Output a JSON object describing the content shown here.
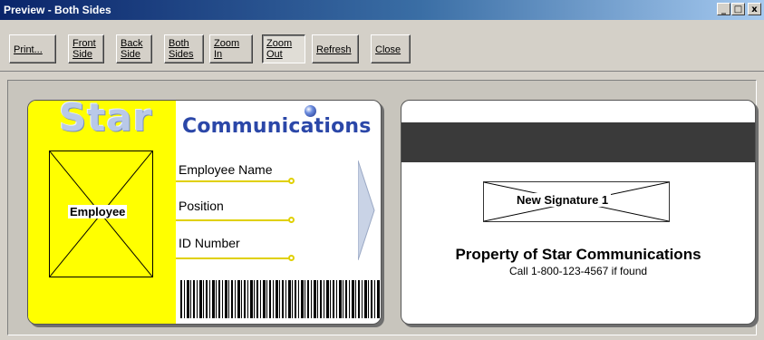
{
  "window": {
    "title": "Preview - Both Sides",
    "controls": {
      "minimize": "_",
      "maximize": "□",
      "close": "x"
    }
  },
  "toolbar": {
    "print": "Print...",
    "front_side": "Front\nSide",
    "back_side": "Back\nSide",
    "both_sides": "Both\nSides",
    "zoom_in": "Zoom\nIn",
    "zoom_out": "Zoom\nOut",
    "refresh": "Refresh",
    "close": "Close"
  },
  "front": {
    "logo_star": "Star",
    "logo_comm": "Communications",
    "photo_label": "Employee",
    "fields": [
      "Employee Name",
      "Position",
      "ID Number"
    ]
  },
  "back": {
    "signature_label": "New Signature 1",
    "property_text": "Property of Star Communications",
    "call_text": "Call 1-800-123-4567 if found"
  },
  "colors": {
    "card_yellow": "#ffff00",
    "logo_blue": "#2b47a8",
    "mag_strip": "#3a3a3a",
    "titlebar_start": "#0a246a"
  }
}
